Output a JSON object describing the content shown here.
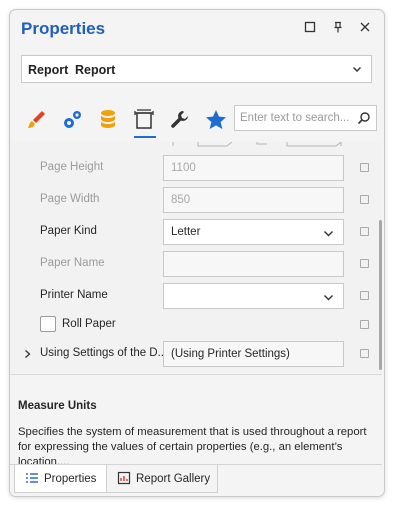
{
  "panel": {
    "title": "Properties",
    "window_controls": [
      "maximize-icon",
      "pin-icon",
      "close-icon"
    ]
  },
  "selector": {
    "type": "Report",
    "name": "Report"
  },
  "toolbar": {
    "tabs": [
      "brush-icon",
      "gears-icon",
      "database-icon",
      "layout-icon",
      "wrench-icon",
      "star-icon"
    ],
    "active_tab": "layout-icon",
    "search_placeholder": "Enter text to search..."
  },
  "properties": [
    {
      "label": "Page Height",
      "value": "1100",
      "enabled": false
    },
    {
      "label": "Page Width",
      "value": "850",
      "enabled": false
    },
    {
      "label": "Paper Kind",
      "value": "Letter",
      "enabled": true,
      "dropdown": true
    },
    {
      "label": "Paper Name",
      "value": "",
      "enabled": false
    },
    {
      "label": "Printer Name",
      "value": "",
      "enabled": true,
      "dropdown": true
    },
    {
      "label": "Roll Paper",
      "checkbox": true,
      "checked": false
    },
    {
      "label": "Using Settings of the D...",
      "value": "(Using Printer Settings)",
      "expandable": true
    }
  ],
  "description": {
    "heading": "Measure Units",
    "text": "Specifies the system of measurement that is used throughout a report for expressing the values of certain properties (e.g., an element’s location,..."
  },
  "bottom_tabs": [
    {
      "label": "Properties",
      "active": true
    },
    {
      "label": "Report Gallery",
      "active": false
    }
  ],
  "colors": {
    "accent": "#1f5fbf",
    "brush": "#e8401c",
    "gears": "#1f6dd1",
    "database": "#f0a00a",
    "star": "#1f6dd1"
  }
}
